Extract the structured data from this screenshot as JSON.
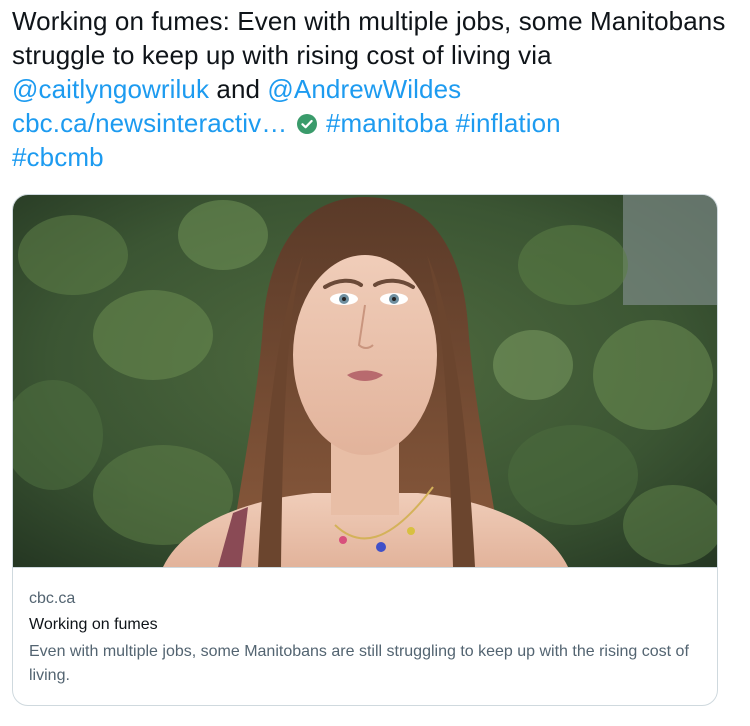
{
  "tweet": {
    "text_intro": "Working on fumes: Even with multiple jobs, some Manitobans struggle to keep up with rising cost of living via ",
    "mention_1": "@caitlyngowriluk",
    "text_and": " and ",
    "mention_2": "@AndrewWildes",
    "link": "cbc.ca/newsinteractiv…",
    "hashtag_1": "#manitoba",
    "hashtag_2": "#inflation",
    "hashtag_3": "#cbcmb"
  },
  "card": {
    "domain": "cbc.ca",
    "title": "Working on fumes",
    "description": "Even with multiple jobs, some Manitobans are still struggling to keep up with the rising cost of living."
  },
  "colors": {
    "link_blue": "#1d9bf0",
    "text_primary": "#0f1419",
    "text_secondary": "#536471",
    "verified_badge": "#3a9b6b"
  },
  "icons": {
    "verified": "verified-check-icon"
  }
}
